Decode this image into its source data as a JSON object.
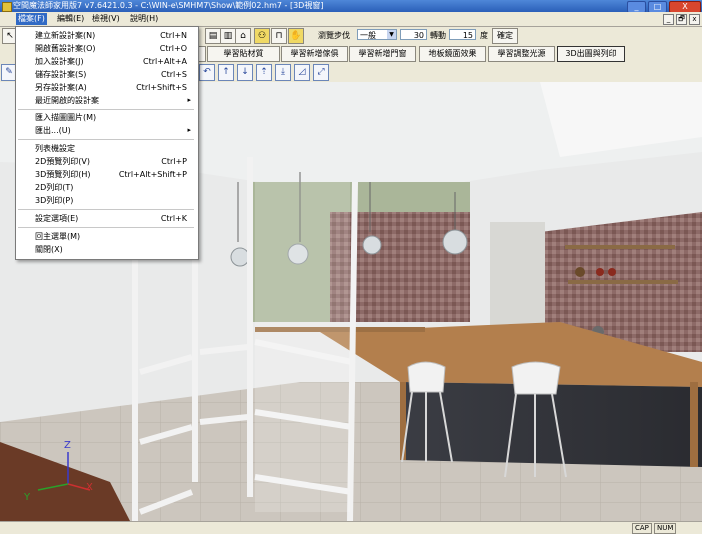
{
  "window": {
    "title": "空間魔法師家用版7  v7.6421.0.3 - C:\\WIN-e\\SMHM7\\Show\\範例02.hm7 - [3D視窗]",
    "min_glyph": "_",
    "max_glyph": "□",
    "close_glyph": "X"
  },
  "menubar": {
    "items": [
      "檔案(F)",
      "編輯(E)",
      "檢視(V)",
      "說明(H)"
    ],
    "mdi": {
      "min": "_",
      "restore": "🗗",
      "close": "x"
    }
  },
  "file_menu": {
    "items": [
      {
        "label": "建立新設計案(N)",
        "shortcut": "Ctrl+N"
      },
      {
        "label": "開啟舊設計案(O)",
        "shortcut": "Ctrl+O"
      },
      {
        "label": "加入設計案(J)",
        "shortcut": "Ctrl+Alt+A"
      },
      {
        "label": "儲存設計案(S)",
        "shortcut": "Ctrl+S"
      },
      {
        "label": "另存設計案(A)",
        "shortcut": "Ctrl+Shift+S"
      },
      {
        "label": "最近開啟的設計案",
        "shortcut": ""
      },
      {
        "label": "匯入描圖圖片(M)",
        "shortcut": ""
      },
      {
        "label": "匯出...(U)",
        "shortcut": ""
      },
      {
        "label": "列表機設定",
        "shortcut": ""
      },
      {
        "label": "2D預覽列印(V)",
        "shortcut": "Ctrl+P"
      },
      {
        "label": "3D預覽列印(H)",
        "shortcut": "Ctrl+Alt+Shift+P"
      },
      {
        "label": "2D列印(T)",
        "shortcut": ""
      },
      {
        "label": "3D列印(P)",
        "shortcut": ""
      },
      {
        "label": "設定選項(E)",
        "shortcut": "Ctrl+K"
      },
      {
        "label": "回主選單(M)",
        "shortcut": ""
      },
      {
        "label": "關閉(X)",
        "shortcut": ""
      }
    ]
  },
  "nav_controls": {
    "step_label": "瀏覽步伐",
    "step_value": "一般",
    "distance_value": "30",
    "rotate_label": "轉動",
    "rotate_value": "15",
    "degree_unit": "度",
    "confirm_label": "確定"
  },
  "learn_buttons": [
    "學習貼材質",
    "學習新增傢俱",
    "學習新增門窗",
    "地板鏡面效果",
    "學習調整光源",
    "3D出圖與列印"
  ],
  "status": {
    "cap": "CAP",
    "num": "NUM"
  },
  "axes": {
    "z": "Z",
    "y": "Y",
    "x": "X"
  },
  "icons": {
    "toolbar": [
      "new-icon",
      "open-icon",
      "save-icon",
      "house-icon",
      "walk-icon",
      "door-icon",
      "hand-icon"
    ]
  }
}
